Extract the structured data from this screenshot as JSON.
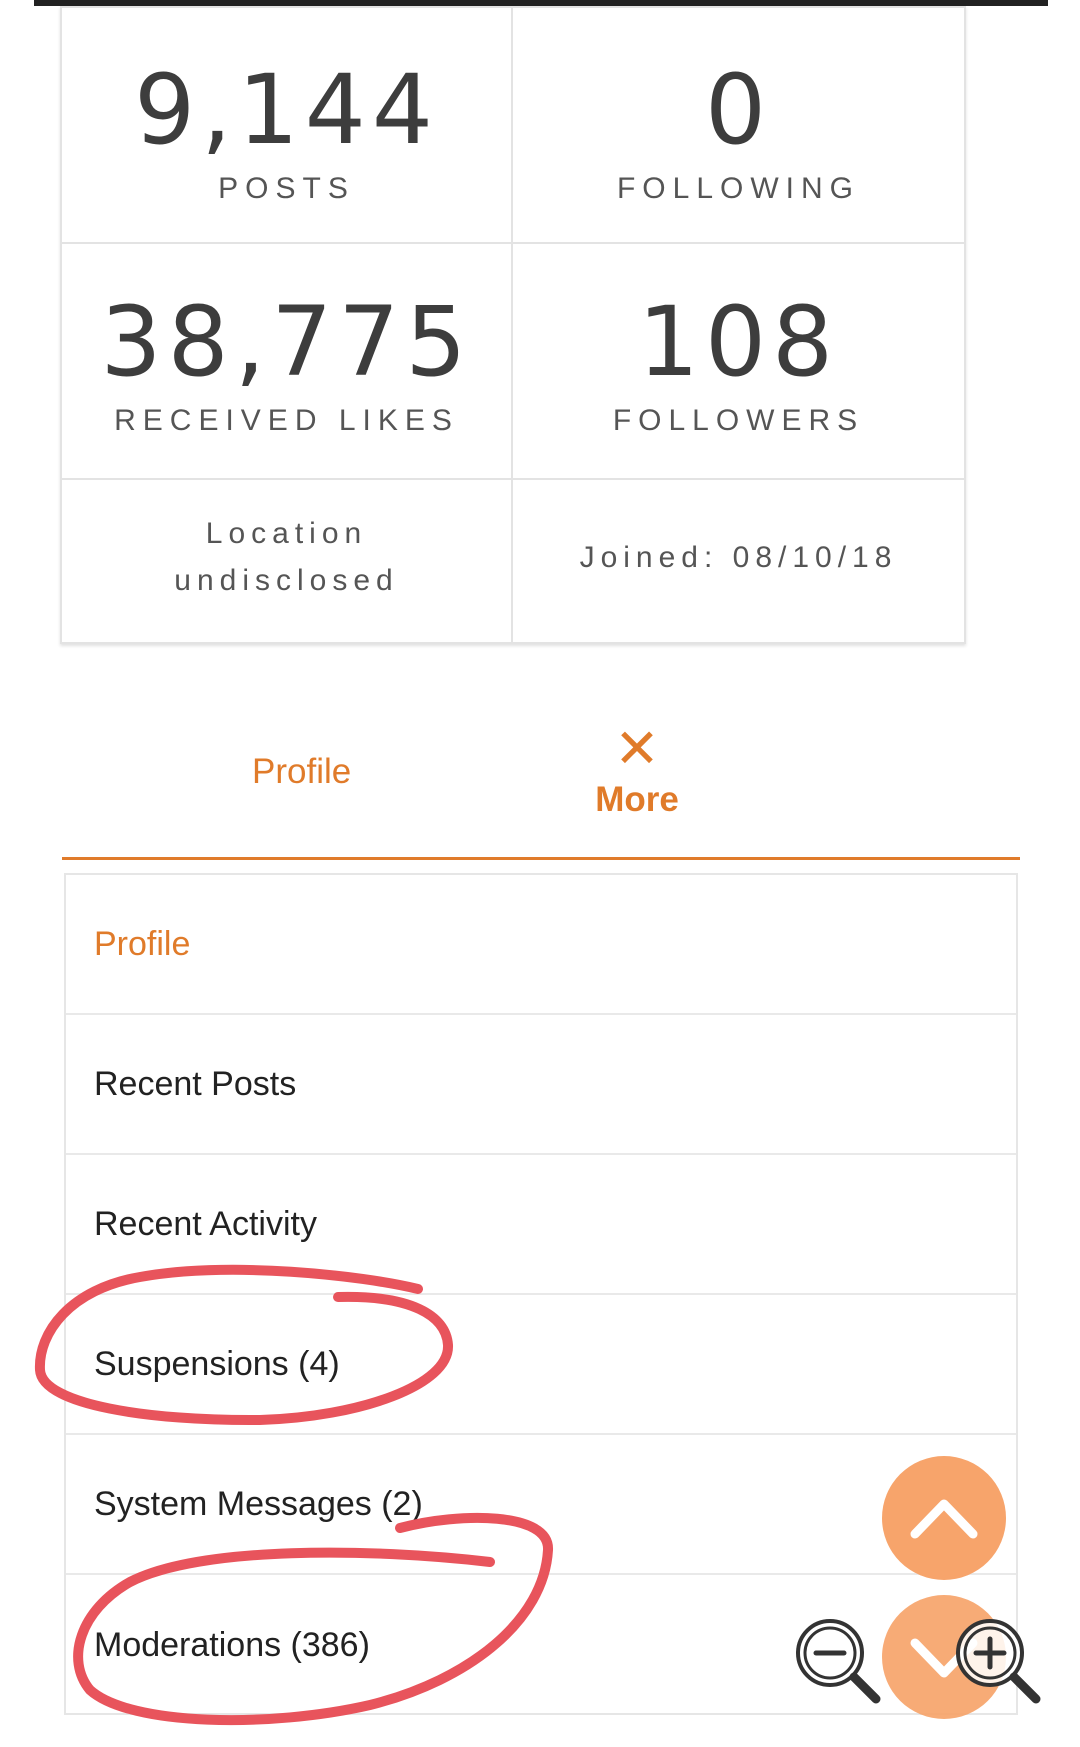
{
  "stats": {
    "posts": {
      "value": "9,144",
      "label": "POSTS"
    },
    "following": {
      "value": "0",
      "label": "FOLLOWING"
    },
    "received_likes": {
      "value": "38,775",
      "label": "RECEIVED LIKES"
    },
    "followers": {
      "value": "108",
      "label": "FOLLOWERS"
    },
    "location": {
      "line1": "Location",
      "line2": "undisclosed"
    },
    "joined": "Joined: 08/10/18"
  },
  "tabs": {
    "profile": "Profile",
    "more": "More",
    "more_icon": "close-x-icon"
  },
  "menu": {
    "items": [
      {
        "label": "Profile",
        "active": true
      },
      {
        "label": "Recent Posts",
        "active": false
      },
      {
        "label": "Recent Activity",
        "active": false
      },
      {
        "label": "Suspensions (4)",
        "active": false
      },
      {
        "label": "System Messages (2)",
        "active": false
      },
      {
        "label": "Moderations (386)",
        "active": false
      }
    ]
  },
  "colors": {
    "accent": "#e07b2a",
    "fab": "#f7a46b",
    "annotation": "#e8545c"
  },
  "icons": {
    "scroll_up": "chevron-up-icon",
    "scroll_down": "chevron-down-icon",
    "zoom_out": "zoom-out-icon",
    "zoom_in": "zoom-in-icon"
  }
}
